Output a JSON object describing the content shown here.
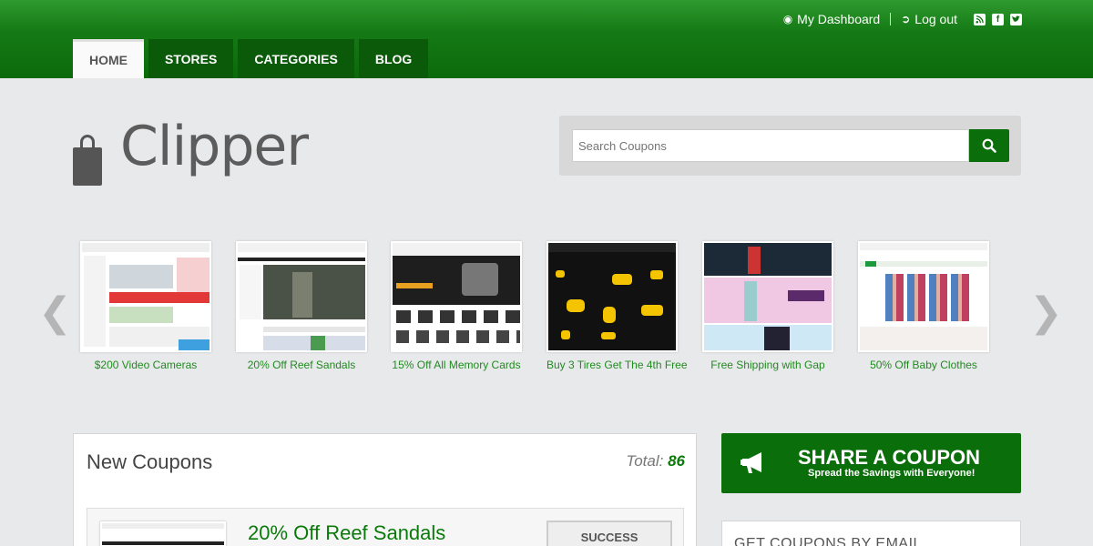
{
  "header": {
    "dashboard_label": "My Dashboard",
    "logout_label": "Log out",
    "social": [
      "rss-icon",
      "facebook-icon",
      "twitter-icon"
    ]
  },
  "nav": {
    "tabs": [
      {
        "label": "HOME",
        "active": true
      },
      {
        "label": "STORES",
        "active": false
      },
      {
        "label": "CATEGORIES",
        "active": false
      },
      {
        "label": "BLOG",
        "active": false
      }
    ]
  },
  "logo": {
    "text": "Clipper"
  },
  "search": {
    "placeholder": "Search Coupons"
  },
  "carousel": {
    "slides": [
      {
        "caption": "$200 Video Cameras"
      },
      {
        "caption": "20% Off Reef Sandals"
      },
      {
        "caption": "15% Off All Memory Cards"
      },
      {
        "caption": "Buy 3 Tires Get The 4th Free"
      },
      {
        "caption": "Free Shipping with Gap"
      },
      {
        "caption": "50% Off Baby Clothes"
      }
    ]
  },
  "new_coupons": {
    "title": "New Coupons",
    "total_label": "Total:",
    "total_value": "86",
    "first_coupon": {
      "title": "20% Off Reef Sandals",
      "button": "SUCCESS"
    }
  },
  "share": {
    "title": "SHARE A COUPON",
    "subtitle": "Spread the Savings with Everyone!"
  },
  "email_widget": {
    "title": "GET COUPONS BY EMAIL"
  },
  "colors": {
    "brand_green": "#0a6e0a",
    "link_green": "#218a21",
    "background": "#e8e9ea"
  }
}
